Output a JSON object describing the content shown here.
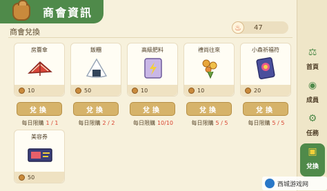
{
  "header": {
    "title": "商會資訊",
    "subtitle": "商會兌換"
  },
  "currency": {
    "amount": "47"
  },
  "button_label": "兌換",
  "limit_label": "每日限購",
  "items": [
    {
      "name": "房簷傘",
      "price": "10",
      "limit": "1 / 1",
      "art": "umbrella-icon"
    },
    {
      "name": "飯糰",
      "price": "50",
      "limit": "2 / 2",
      "art": "onigiri-icon"
    },
    {
      "name": "高級肥料",
      "price": "10",
      "limit": "10/10",
      "art": "fertilizer-bag-icon"
    },
    {
      "name": "禮尚往來",
      "price": "10",
      "limit": "5 / 5",
      "art": "gift-flowers-icon"
    },
    {
      "name": "小森祈福符",
      "price": "20",
      "limit": "5 / 5",
      "art": "charm-card-icon"
    },
    {
      "name": "美容券",
      "price": "50",
      "art": "ticket-icon"
    }
  ],
  "sidebar": [
    {
      "label": "首頁",
      "icon": "scale-icon"
    },
    {
      "label": "成員",
      "icon": "member-icon"
    },
    {
      "label": "任務",
      "icon": "gear-icon"
    },
    {
      "label": "兌換",
      "icon": "gift-icon"
    }
  ],
  "watermark": "西城游戏网",
  "colors": {
    "accent": "#4f8a4a",
    "button": "#d6b36a",
    "limit_value": "#d9432f"
  }
}
